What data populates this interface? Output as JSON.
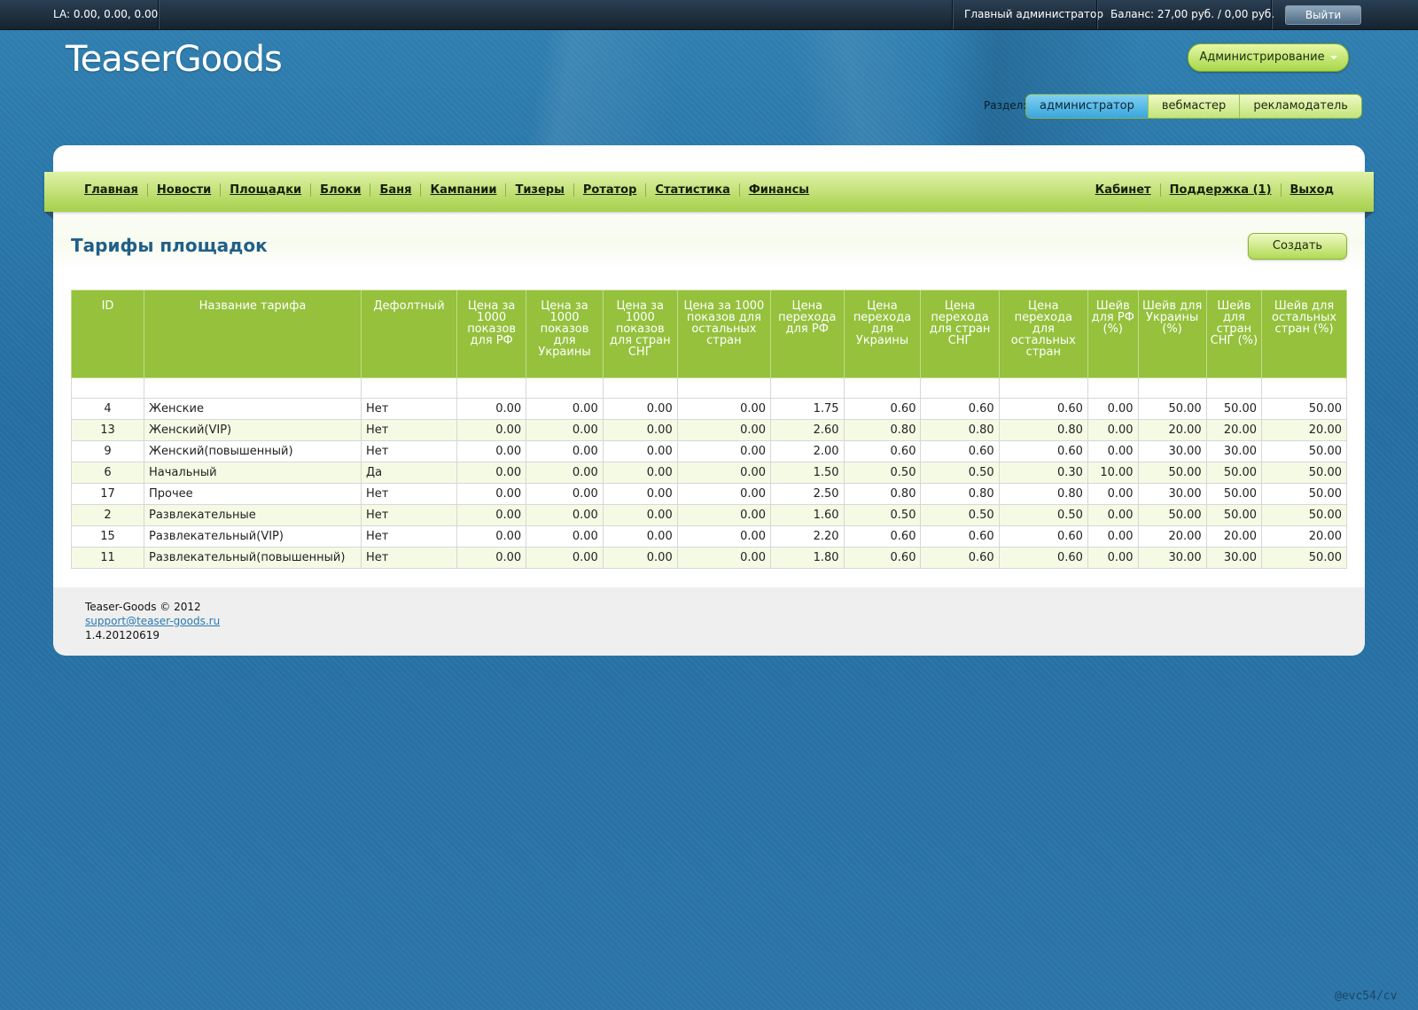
{
  "topbar": {
    "la": "LA: 0.00, 0.00, 0.00",
    "admin_label": "Главный администратор",
    "balance": "Баланс: 27,00 руб. / 0,00 руб.",
    "logout_label": "Выйти"
  },
  "header": {
    "logo": "TeaserGoods",
    "admin_menu_label": "Администрирование",
    "section_label": "Раздел:",
    "sections": [
      "администратор",
      "вебмастер",
      "рекламодатель"
    ]
  },
  "nav": {
    "left": [
      "Главная",
      "Новости",
      "Площадки",
      "Блоки",
      "Баня",
      "Кампании",
      "Тизеры",
      "Ротатор",
      "Статистика",
      "Финансы"
    ],
    "right": [
      "Кабинет",
      "Поддержка (1)",
      "Выход"
    ]
  },
  "page": {
    "title": "Тарифы площадок",
    "create_label": "Создать"
  },
  "table": {
    "headers": [
      "ID",
      "Название тарифа",
      "Дефолтный",
      "Цена за 1000 показов для РФ",
      "Цена за 1000 показов для Украины",
      "Цена за 1000 показов для стран СНГ",
      "Цена за 1000 показов для остальных стран",
      "Цена перехода для РФ",
      "Цена перехода для Украины",
      "Цена перехода для стран СНГ",
      "Цена перехода для остальных стран",
      "Шейв для РФ (%)",
      "Шейв для Украины (%)",
      "Шейв для стран СНГ (%)",
      "Шейв для остальных стран (%)"
    ],
    "rows": [
      [
        "4",
        "Женские",
        "Нет",
        "0.00",
        "0.00",
        "0.00",
        "0.00",
        "1.75",
        "0.60",
        "0.60",
        "0.60",
        "0.00",
        "50.00",
        "50.00",
        "50.00"
      ],
      [
        "13",
        "Женский(VIP)",
        "Нет",
        "0.00",
        "0.00",
        "0.00",
        "0.00",
        "2.60",
        "0.80",
        "0.80",
        "0.80",
        "0.00",
        "20.00",
        "20.00",
        "20.00"
      ],
      [
        "9",
        "Женский(повышенный)",
        "Нет",
        "0.00",
        "0.00",
        "0.00",
        "0.00",
        "2.00",
        "0.60",
        "0.60",
        "0.60",
        "0.00",
        "30.00",
        "30.00",
        "50.00"
      ],
      [
        "6",
        "Начальный",
        "Да",
        "0.00",
        "0.00",
        "0.00",
        "0.00",
        "1.50",
        "0.50",
        "0.50",
        "0.30",
        "10.00",
        "50.00",
        "50.00",
        "50.00"
      ],
      [
        "17",
        "Прочее",
        "Нет",
        "0.00",
        "0.00",
        "0.00",
        "0.00",
        "2.50",
        "0.80",
        "0.80",
        "0.80",
        "0.00",
        "30.00",
        "50.00",
        "50.00"
      ],
      [
        "2",
        "Развлекательные",
        "Нет",
        "0.00",
        "0.00",
        "0.00",
        "0.00",
        "1.60",
        "0.50",
        "0.50",
        "0.50",
        "0.00",
        "50.00",
        "50.00",
        "50.00"
      ],
      [
        "15",
        "Развлекательный(VIP)",
        "Нет",
        "0.00",
        "0.00",
        "0.00",
        "0.00",
        "2.20",
        "0.60",
        "0.60",
        "0.60",
        "0.00",
        "20.00",
        "20.00",
        "20.00"
      ],
      [
        "11",
        "Развлекательный(повышенный)",
        "Нет",
        "0.00",
        "0.00",
        "0.00",
        "0.00",
        "1.80",
        "0.60",
        "0.60",
        "0.60",
        "0.00",
        "30.00",
        "30.00",
        "50.00"
      ]
    ]
  },
  "footer": {
    "copyright": "Teaser-Goods © 2012",
    "email": "support@teaser-goods.ru",
    "version": "1.4.20120619"
  },
  "watermark": "@evc54/cv"
}
